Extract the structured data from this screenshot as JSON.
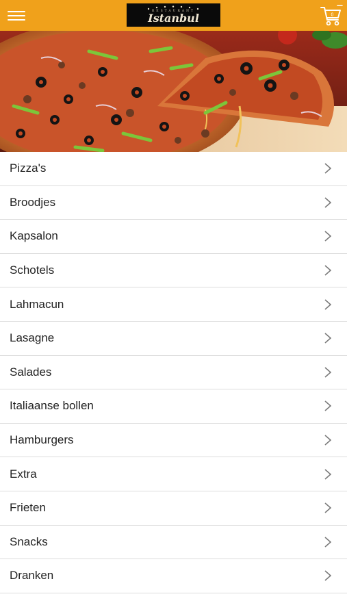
{
  "header": {
    "menu_icon": "hamburger-menu-icon",
    "logo_text": "Istanbul",
    "logo_subtext": "RESTAURANT",
    "cart_icon": "shopping-cart-icon",
    "cart_count": "0",
    "background_color": "#f0a11b"
  },
  "hero": {
    "image": "pizza-photo"
  },
  "categories": [
    {
      "label": "Pizza's"
    },
    {
      "label": "Broodjes"
    },
    {
      "label": "Kapsalon"
    },
    {
      "label": "Schotels"
    },
    {
      "label": "Lahmacun"
    },
    {
      "label": "Lasagne"
    },
    {
      "label": "Salades"
    },
    {
      "label": "Italiaanse bollen"
    },
    {
      "label": "Hamburgers"
    },
    {
      "label": "Extra"
    },
    {
      "label": "Frieten"
    },
    {
      "label": "Snacks"
    },
    {
      "label": "Dranken"
    }
  ],
  "chevron_icon": "chevron-right-icon"
}
